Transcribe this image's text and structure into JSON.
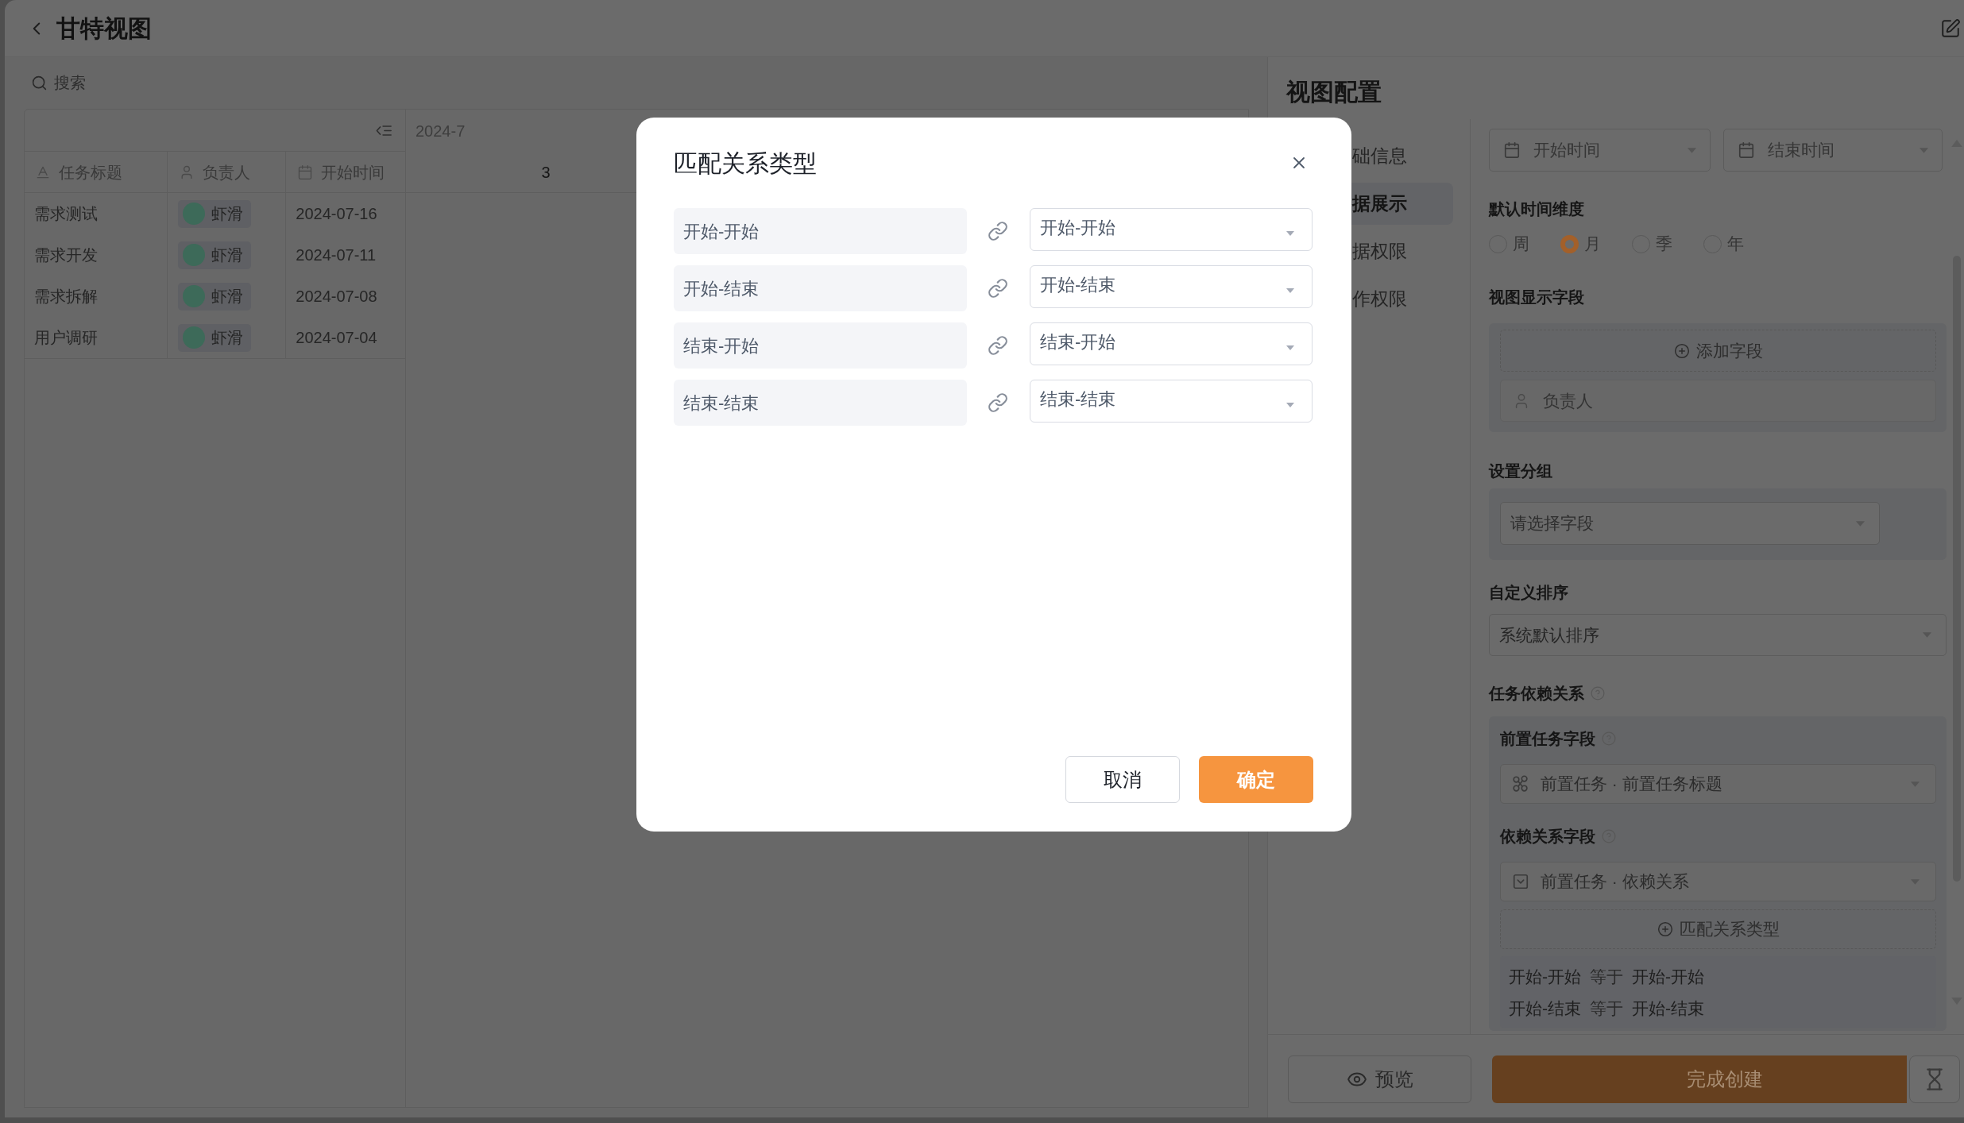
{
  "header": {
    "title": "甘特视图"
  },
  "search": {
    "placeholder": "搜索"
  },
  "table": {
    "columns": [
      {
        "label": "任务标题",
        "kind": "text"
      },
      {
        "label": "负责人",
        "kind": "person"
      },
      {
        "label": "开始时间",
        "kind": "date"
      }
    ],
    "rows": [
      {
        "title": "需求测试",
        "assignee": "虾滑",
        "start": "2024-07-16"
      },
      {
        "title": "需求开发",
        "assignee": "虾滑",
        "start": "2024-07-11"
      },
      {
        "title": "需求拆解",
        "assignee": "虾滑",
        "start": "2024-07-08"
      },
      {
        "title": "用户调研",
        "assignee": "虾滑",
        "start": "2024-07-04"
      }
    ]
  },
  "timeline": {
    "month": "2024-7",
    "day": "3"
  },
  "config": {
    "title": "视图配置",
    "nav": [
      {
        "label": "础信息",
        "selected": false
      },
      {
        "label": "据展示",
        "selected": true
      },
      {
        "label": "据权限",
        "selected": false
      },
      {
        "label": "作权限",
        "selected": false
      }
    ],
    "date_fields": [
      {
        "value": "开始时间"
      },
      {
        "value": "结束时间"
      }
    ],
    "time_dimension": {
      "label": "默认时间维度",
      "options": [
        {
          "label": "周",
          "selected": false
        },
        {
          "label": "月",
          "selected": true
        },
        {
          "label": "季",
          "selected": false
        },
        {
          "label": "年",
          "selected": false
        }
      ]
    },
    "display_fields": {
      "label": "视图显示字段",
      "add_button": "添加字段",
      "items": [
        {
          "label": "负责人"
        }
      ]
    },
    "grouping": {
      "label": "设置分组",
      "placeholder": "请选择字段"
    },
    "sorting": {
      "label": "自定义排序",
      "value": "系统默认排序"
    },
    "dependency": {
      "label": "任务依赖关系",
      "predecessor_label": "前置任务字段",
      "predecessor_value": "前置任务 · 前置任务标题",
      "relation_label": "依赖关系字段",
      "relation_value": "前置任务 · 依赖关系",
      "match_button": "匹配关系类型",
      "mappings": [
        {
          "source": "开始-开始",
          "relation": "等于",
          "target": "开始-开始"
        },
        {
          "source": "开始-结束",
          "relation": "等于",
          "target": "开始-结束"
        }
      ]
    }
  },
  "footer": {
    "preview": "预览",
    "submit": "完成创建"
  },
  "dialog": {
    "title": "匹配关系类型",
    "rows": [
      {
        "source": "开始-开始",
        "target": "开始-开始"
      },
      {
        "source": "开始-结束",
        "target": "开始-结束"
      },
      {
        "source": "结束-开始",
        "target": "结束-开始"
      },
      {
        "source": "结束-结束",
        "target": "结束-结束"
      }
    ],
    "cancel": "取消",
    "confirm": "确定"
  }
}
